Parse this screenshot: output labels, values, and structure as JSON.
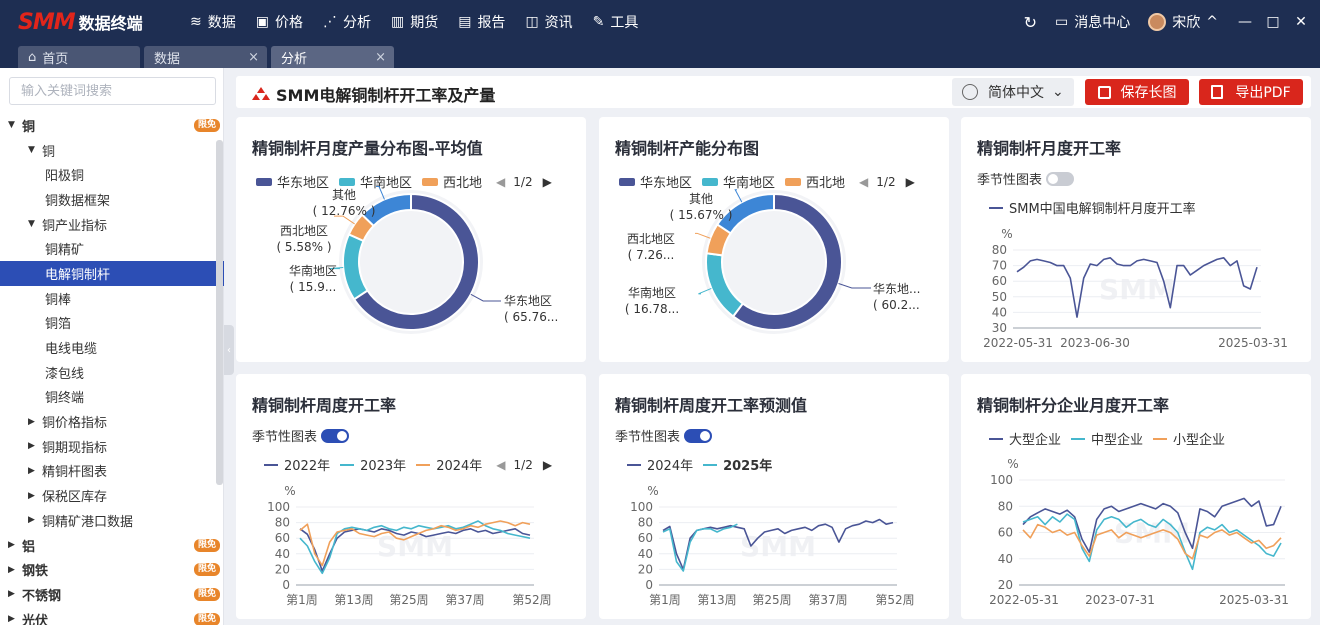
{
  "app": {
    "logo_brand": "SMM",
    "logo_name": "数据终端",
    "nav": [
      {
        "label": "数据",
        "icon": "layers-icon",
        "glyph": "≋"
      },
      {
        "label": "价格",
        "icon": "chart-box-icon",
        "glyph": "▣"
      },
      {
        "label": "分析",
        "icon": "analysis-icon",
        "glyph": "⋰"
      },
      {
        "label": "期货",
        "icon": "bar-chart-icon",
        "glyph": "▥"
      },
      {
        "label": "报告",
        "icon": "report-icon",
        "glyph": "▤"
      },
      {
        "label": "资讯",
        "icon": "news-icon",
        "glyph": "◫"
      },
      {
        "label": "工具",
        "icon": "wrench-icon",
        "glyph": "✎"
      }
    ],
    "refresh_glyph": "↻",
    "message_center": "消息中心",
    "message_glyph": "▭",
    "user": "宋欣",
    "chevron": "^",
    "win_min": "—",
    "win_max": "□",
    "win_close": "✕"
  },
  "tabs": [
    {
      "label": "首页",
      "icon": "home-icon",
      "glyph": "⌂"
    },
    {
      "label": "数据",
      "close": "×"
    },
    {
      "label": "分析",
      "close": "×"
    }
  ],
  "sidebar": {
    "search_placeholder": "输入关键词搜索",
    "items": [
      {
        "label": "铜",
        "level": 0,
        "caret": "▼",
        "badge": "限免"
      },
      {
        "label": "铜",
        "level": 1,
        "caret": "▼"
      },
      {
        "label": "阳极铜",
        "level": 2
      },
      {
        "label": "铜数据框架",
        "level": 2
      },
      {
        "label": "铜产业指标",
        "level": 1,
        "caret": "▼"
      },
      {
        "label": "铜精矿",
        "level": 2
      },
      {
        "label": "电解铜制杆",
        "level": 2,
        "selected": true
      },
      {
        "label": "铜棒",
        "level": 2
      },
      {
        "label": "铜箔",
        "level": 2
      },
      {
        "label": "电线电缆",
        "level": 2
      },
      {
        "label": "漆包线",
        "level": 2
      },
      {
        "label": "铜终端",
        "level": 2
      },
      {
        "label": "铜价格指标",
        "level": 1,
        "caret": "▶"
      },
      {
        "label": "铜期现指标",
        "level": 1,
        "caret": "▶"
      },
      {
        "label": "精铜杆图表",
        "level": 1,
        "caret": "▶"
      },
      {
        "label": "保税区库存",
        "level": 1,
        "caret": "▶"
      },
      {
        "label": "铜精矿港口数据",
        "level": 1,
        "caret": "▶"
      },
      {
        "label": "铝",
        "level": 0,
        "caret": "▶",
        "badge": "限免"
      },
      {
        "label": "钢铁",
        "level": 0,
        "caret": "▶",
        "badge": "限免"
      },
      {
        "label": "不锈钢",
        "level": 0,
        "caret": "▶",
        "badge": "限免"
      },
      {
        "label": "光伏",
        "level": 0,
        "caret": "▶",
        "badge": "限免"
      }
    ],
    "collapse_glyph": "‹"
  },
  "header": {
    "title": "SMM电解铜制杆开工率及产量",
    "language": "简体中文",
    "lang_chevron": "⌄",
    "save_image": "保存长图",
    "export_pdf": "导出PDF"
  },
  "colors": {
    "navy": "#4a5596",
    "cyan": "#45b7cd",
    "orange": "#f0a05a",
    "blue": "#3d86d6",
    "accent": "#2c4eb5",
    "red": "#d9261c"
  },
  "cards": {
    "c1": {
      "title": "精铜制杆月度产量分布图-平均值",
      "legend": [
        "华东地区",
        "华南地区",
        "西北地"
      ],
      "pager": "1/2"
    },
    "c2": {
      "title": "精铜制杆产能分布图",
      "legend": [
        "华东地区",
        "华南地区",
        "西北地"
      ],
      "pager": "1/2"
    },
    "c3": {
      "title": "精铜制杆月度开工率",
      "toggle_label": "季节性图表",
      "legend": [
        "SMM中国电解铜制杆月度开工率"
      ]
    },
    "c4": {
      "title": "精铜制杆周度开工率",
      "toggle_label": "季节性图表",
      "legend": [
        "2022年",
        "2023年",
        "2024年"
      ],
      "pager": "1/2"
    },
    "c5": {
      "title": "精铜制杆周度开工率预测值",
      "toggle_label": "季节性图表",
      "legend": [
        "2024年",
        "2025年"
      ]
    },
    "c6": {
      "title": "精铜制杆分企业月度开工率",
      "legend": [
        "大型企业",
        "中型企业",
        "小型企业"
      ]
    }
  },
  "chart_data": [
    {
      "type": "pie",
      "title": "精铜制杆月度产量分布图-平均值",
      "slices": [
        {
          "name": "华东地区",
          "label": "华东地区",
          "pct_label": "( 65.76...",
          "value": 65.76,
          "color": "#4a5596"
        },
        {
          "name": "华南地区",
          "label": "华南地区",
          "pct_label": "( 15.9...",
          "value": 15.9,
          "color": "#45b7cd"
        },
        {
          "name": "西北地区",
          "label": "西北地区",
          "pct_label": "( 5.58% )",
          "value": 5.58,
          "color": "#f0a05a"
        },
        {
          "name": "其他",
          "label": "其他",
          "pct_label": "( 12.76% )",
          "value": 12.76,
          "color": "#3d86d6"
        }
      ]
    },
    {
      "type": "pie",
      "title": "精铜制杆产能分布图",
      "slices": [
        {
          "name": "华东地区",
          "label": "华东地...",
          "pct_label": "( 60.2...",
          "value": 60.2,
          "color": "#4a5596"
        },
        {
          "name": "华南地区",
          "label": "华南地区",
          "pct_label": "( 16.78...",
          "value": 16.78,
          "color": "#45b7cd"
        },
        {
          "name": "西北地区",
          "label": "西北地区",
          "pct_label": "( 7.26...",
          "value": 7.26,
          "color": "#f0a05a"
        },
        {
          "name": "其他",
          "label": "其他",
          "pct_label": "( 15.67% )",
          "value": 15.67,
          "color": "#3d86d6"
        }
      ]
    },
    {
      "type": "line",
      "title": "精铜制杆月度开工率",
      "ylabel": "%",
      "ylim": [
        30,
        80
      ],
      "yticks": [
        30,
        40,
        50,
        60,
        70,
        80
      ],
      "xticks": [
        "2022-05-31",
        "2023-06-30",
        "2025-03-31"
      ],
      "series": [
        {
          "name": "SMM中国电解铜制杆月度开工率",
          "color": "#4a5596",
          "values": [
            66,
            69,
            73,
            74,
            73,
            72,
            70,
            70,
            62,
            37,
            62,
            71,
            70,
            74,
            75,
            71,
            70,
            70,
            73,
            74,
            73,
            72,
            60,
            43,
            70,
            70,
            64,
            67,
            70,
            72,
            74,
            75,
            70,
            73,
            57,
            55,
            69
          ]
        }
      ]
    },
    {
      "type": "line",
      "title": "精铜制杆周度开工率",
      "ylabel": "%",
      "ylim": [
        0,
        100
      ],
      "yticks": [
        0,
        20,
        40,
        60,
        80,
        100
      ],
      "xticks": [
        "第1周",
        "第13周",
        "第25周",
        "第37周",
        "第52周"
      ],
      "series": [
        {
          "name": "2022年",
          "color": "#4a5596",
          "values": [
            72,
            65,
            45,
            18,
            40,
            60,
            68,
            70,
            72,
            70,
            68,
            72,
            70,
            66,
            64,
            68,
            66,
            62,
            64,
            66,
            68,
            66,
            70,
            72,
            68,
            70,
            66,
            68,
            70,
            72,
            66,
            64
          ]
        },
        {
          "name": "2023年",
          "color": "#45b7cd",
          "values": [
            60,
            50,
            30,
            15,
            35,
            66,
            72,
            74,
            72,
            70,
            74,
            76,
            72,
            70,
            74,
            72,
            76,
            74,
            72,
            74,
            76,
            72,
            74,
            78,
            82,
            76,
            72,
            70,
            66,
            64,
            62,
            60
          ]
        },
        {
          "name": "2024年",
          "color": "#f0a05a",
          "values": [
            70,
            78,
            40,
            25,
            55,
            68,
            70,
            72,
            66,
            64,
            62,
            66,
            68,
            60,
            58,
            62,
            66,
            70,
            72,
            76,
            74,
            70,
            72,
            76,
            74,
            78,
            80,
            82,
            80,
            76,
            80,
            78
          ]
        }
      ]
    },
    {
      "type": "line",
      "title": "精铜制杆周度开工率预测值",
      "ylabel": "%",
      "ylim": [
        0,
        100
      ],
      "yticks": [
        0,
        20,
        40,
        60,
        80,
        100
      ],
      "xticks": [
        "第1周",
        "第13周",
        "第25周",
        "第37周",
        "第52周"
      ],
      "series": [
        {
          "name": "2024年",
          "color": "#4a5596",
          "values": [
            70,
            75,
            40,
            20,
            60,
            70,
            72,
            74,
            72,
            74,
            76,
            74,
            72,
            50,
            60,
            68,
            70,
            72,
            66,
            70,
            72,
            74,
            70,
            76,
            78,
            74,
            55,
            72,
            76,
            78,
            82,
            80,
            84,
            78,
            80
          ]
        },
        {
          "name": "2025年",
          "color": "#45b7cd",
          "values": [
            68,
            72,
            30,
            18,
            55,
            70,
            72,
            72,
            68,
            72,
            74,
            78
          ]
        }
      ]
    },
    {
      "type": "line",
      "title": "精铜制杆分企业月度开工率",
      "ylabel": "%",
      "ylim": [
        20,
        100
      ],
      "yticks": [
        20,
        40,
        60,
        80,
        100
      ],
      "xticks": [
        "2022-05-31",
        "2023-07-31",
        "2025-03-31"
      ],
      "series": [
        {
          "name": "大型企业",
          "color": "#4a5596",
          "values": [
            66,
            72,
            75,
            78,
            76,
            74,
            77,
            72,
            55,
            45,
            70,
            78,
            80,
            76,
            78,
            80,
            82,
            80,
            78,
            82,
            80,
            75,
            60,
            48,
            78,
            76,
            72,
            80,
            82,
            84,
            86,
            80,
            84,
            65,
            66,
            80
          ]
        },
        {
          "name": "中型企业",
          "color": "#45b7cd",
          "values": [
            68,
            70,
            72,
            66,
            72,
            68,
            74,
            70,
            48,
            38,
            62,
            70,
            72,
            70,
            64,
            68,
            70,
            66,
            64,
            70,
            66,
            60,
            45,
            32,
            60,
            64,
            62,
            66,
            60,
            62,
            58,
            54,
            50,
            44,
            42,
            52
          ]
        },
        {
          "name": "小型企业",
          "color": "#f0a05a",
          "values": [
            62,
            56,
            66,
            64,
            60,
            62,
            58,
            60,
            50,
            42,
            58,
            60,
            62,
            56,
            60,
            58,
            56,
            58,
            60,
            62,
            60,
            55,
            44,
            40,
            58,
            56,
            60,
            62,
            58,
            60,
            56,
            52,
            54,
            48,
            50,
            56
          ]
        }
      ]
    }
  ]
}
